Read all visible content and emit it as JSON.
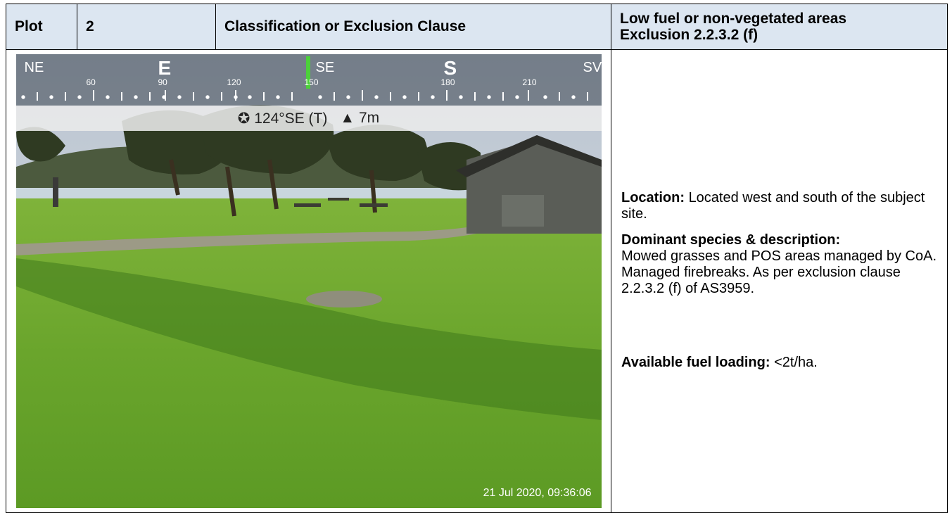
{
  "header": {
    "plot_label": "Plot",
    "plot_number": "2",
    "classification_label": "Classification or Exclusion Clause",
    "classification_value_line1": "Low fuel or non-vegetated areas",
    "classification_value_line2": "Exclusion 2.2.3.2 (f)"
  },
  "photo": {
    "compass": {
      "cardinals": [
        "NE",
        "E",
        "SE",
        "S",
        "SV"
      ],
      "degrees": [
        "60",
        "90",
        "120",
        "150",
        "180",
        "210"
      ]
    },
    "heading": "124°SE (T)",
    "altitude": "7m",
    "timestamp": "21 Jul 2020, 09:36:06"
  },
  "description": {
    "location_label": "Location:",
    "location_text": "Located west and south of the subject site.",
    "species_label": "Dominant species & description:",
    "species_text": "Mowed grasses and POS areas managed by CoA. Managed firebreaks. As per exclusion clause 2.2.3.2 (f) of AS3959.",
    "fuel_label": "Available fuel loading:",
    "fuel_text": "<2t/ha."
  },
  "colors": {
    "header_bg": "#dce6f1",
    "needle": "#4cd03a"
  }
}
